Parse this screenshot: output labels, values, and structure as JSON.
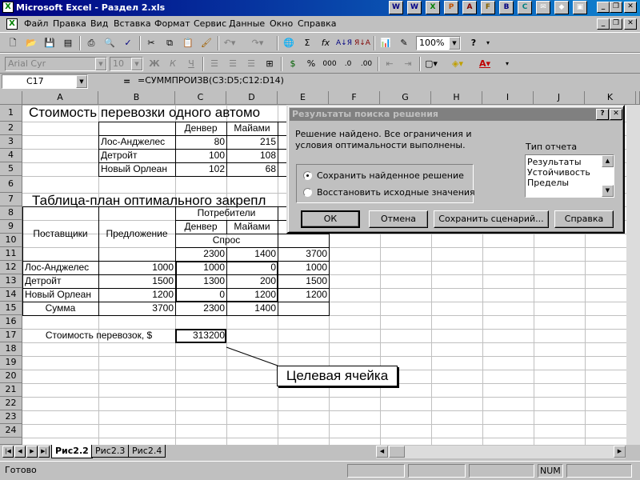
{
  "window": {
    "title": "Microsoft Excel - Раздел 2.xls",
    "app_icon": "X"
  },
  "office_bar": [
    "W",
    "X",
    "P",
    "A",
    "F",
    "B",
    "C"
  ],
  "menu": [
    "Файл",
    "Правка",
    "Вид",
    "Вставка",
    "Формат",
    "Сервис",
    "Данные",
    "Окно",
    "Справка"
  ],
  "toolbar": {
    "zoom": "100%",
    "font": "Arial Cyr",
    "size": "10",
    "bold": "Ж",
    "italic": "К",
    "underline": "Ч",
    "sum": "Σ",
    "fx": "fx"
  },
  "formula_bar": {
    "cell_ref": "C17",
    "equals": "=",
    "formula": "=СУММПРОИЗВ(C3:D5;C12:D14)"
  },
  "columns": [
    "A",
    "B",
    "C",
    "D",
    "E",
    "F",
    "G",
    "H",
    "I",
    "J",
    "K"
  ],
  "rows": [
    "1",
    "2",
    "3",
    "4",
    "5",
    "6",
    "7",
    "8",
    "9",
    "10",
    "11",
    "12",
    "13",
    "14",
    "15",
    "16",
    "17",
    "18",
    "19",
    "20",
    "21",
    "22",
    "23",
    "24"
  ],
  "sheet": {
    "title1": "Стоимость перевозки одного автомо",
    "r2": {
      "c": "Денвер",
      "d": "Майами",
      "e": ""
    },
    "r3": {
      "b": "Лос-Анджелес",
      "c": "80",
      "d": "215"
    },
    "r4": {
      "b": "Детройт",
      "c": "100",
      "d": "108"
    },
    "r5": {
      "b": "Новый Орлеан",
      "c": "102",
      "d": "68"
    },
    "title7": "Таблица-план оптимального закрепл",
    "r8": {
      "cd": "Потребители"
    },
    "a9": "Поставщики",
    "b9": "Предложение",
    "r9": {
      "c": "Денвер",
      "d": "Майами"
    },
    "r10": {
      "cd": "Спрос"
    },
    "r11": {
      "c": "2300",
      "d": "1400",
      "e": "3700"
    },
    "r12": {
      "a": "Лос-Анджелес",
      "b": "1000",
      "c": "1000",
      "d": "0",
      "e": "1000"
    },
    "r13": {
      "a": "Детройт",
      "b": "1500",
      "c": "1300",
      "d": "200",
      "e": "1500"
    },
    "r14": {
      "a": "Новый Орлеан",
      "b": "1200",
      "c": "0",
      "d": "1200",
      "e": "1200"
    },
    "r15": {
      "a": "Сумма",
      "b": "3700",
      "c": "2300",
      "d": "1400"
    },
    "r17": {
      "ab": "Стоимость перевозок, $",
      "c": "313200"
    }
  },
  "callout": "Целевая ячейка",
  "dialog": {
    "title": "Результаты поиска решения",
    "help": "?",
    "close": "✕",
    "message": "Решение найдено. Все ограничения и условия оптимальности выполнены.",
    "report_type_label": "Тип отчета",
    "reports": [
      "Результаты",
      "Устойчивость",
      "Пределы"
    ],
    "option_keep": "Сохранить найденное решение",
    "option_restore": "Восстановить исходные значения",
    "ok": "ОК",
    "cancel": "Отмена",
    "save_scenario": "Сохранить сценарий...",
    "help_btn": "Справка"
  },
  "sheet_tabs": [
    "Рис2.2",
    "Рис2.3",
    "Рис2.4"
  ],
  "status": {
    "ready": "Готово",
    "num": "NUM"
  }
}
